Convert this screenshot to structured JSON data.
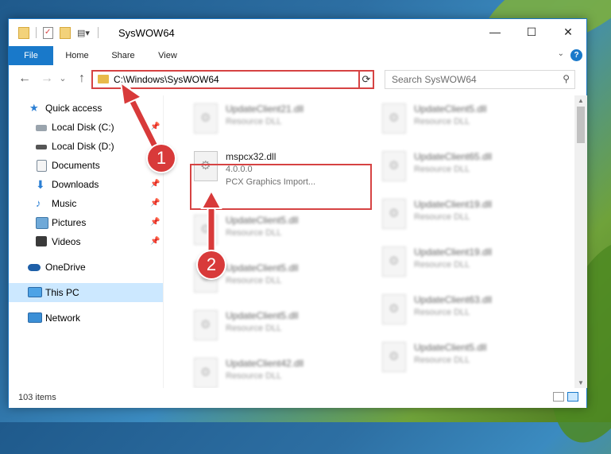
{
  "window": {
    "title": "SysWOW64",
    "controls": {
      "minimize": "—",
      "maximize": "☐",
      "close": "✕"
    }
  },
  "ribbon": {
    "tabs": [
      "File",
      "Home",
      "Share",
      "View"
    ],
    "help": "?"
  },
  "navigation": {
    "back": "←",
    "forward": "→",
    "history": "⌄",
    "up": "↑",
    "address_path": "C:\\Windows\\SysWOW64",
    "refresh": "⟳",
    "search_placeholder": "Search SysWOW64"
  },
  "sidebar": {
    "items": [
      {
        "label": "Quick access",
        "icon": "star-icon",
        "pinned": false
      },
      {
        "label": "Local Disk (C:)",
        "icon": "drive-icon",
        "pinned": true
      },
      {
        "label": "Local Disk (D:)",
        "icon": "drive-icon",
        "pinned": true
      },
      {
        "label": "Documents",
        "icon": "documents-icon",
        "pinned": true
      },
      {
        "label": "Downloads",
        "icon": "download-icon",
        "pinned": true
      },
      {
        "label": "Music",
        "icon": "music-icon",
        "pinned": true
      },
      {
        "label": "Pictures",
        "icon": "pictures-icon",
        "pinned": true
      },
      {
        "label": "Videos",
        "icon": "videos-icon",
        "pinned": true
      },
      {
        "label": "OneDrive",
        "icon": "cloud-icon",
        "pinned": false
      },
      {
        "label": "This PC",
        "icon": "computer-icon",
        "pinned": false,
        "selected": true
      },
      {
        "label": "Network",
        "icon": "network-icon",
        "pinned": false
      }
    ]
  },
  "files": {
    "highlighted": {
      "name": "mspcx32.dll",
      "version": "4.0.0.0",
      "description": "PCX Graphics Import..."
    },
    "left_column": [
      {
        "name": "UpdateClient21.dll",
        "type": "Resource DLL"
      },
      {
        "name": "UpdateClient5.dll",
        "type": "Resource DLL"
      },
      {
        "name": "UpdateClient5.dll",
        "type": "Resource DLL"
      },
      {
        "name": "UpdateClient5.dll",
        "type": "Resource DLL"
      },
      {
        "name": "UpdateClient42.dll",
        "type": "Resource DLL"
      }
    ],
    "right_column": [
      {
        "name": "UpdateClient5.dll",
        "type": "Resource DLL"
      },
      {
        "name": "UpdateClient65.dll",
        "type": "Resource DLL"
      },
      {
        "name": "UpdateClient19.dll",
        "type": "Resource DLL"
      },
      {
        "name": "UpdateClient19.dll",
        "type": "Resource DLL"
      },
      {
        "name": "UpdateClient63.dll",
        "type": "Resource DLL"
      },
      {
        "name": "UpdateClient5.dll",
        "type": "Resource DLL"
      }
    ]
  },
  "status": {
    "item_count": "103 items"
  },
  "annotations": {
    "step1": "1",
    "step2": "2"
  },
  "colors": {
    "accent": "#1979ca",
    "highlight": "#d64343",
    "badge": "#d83a3a"
  }
}
